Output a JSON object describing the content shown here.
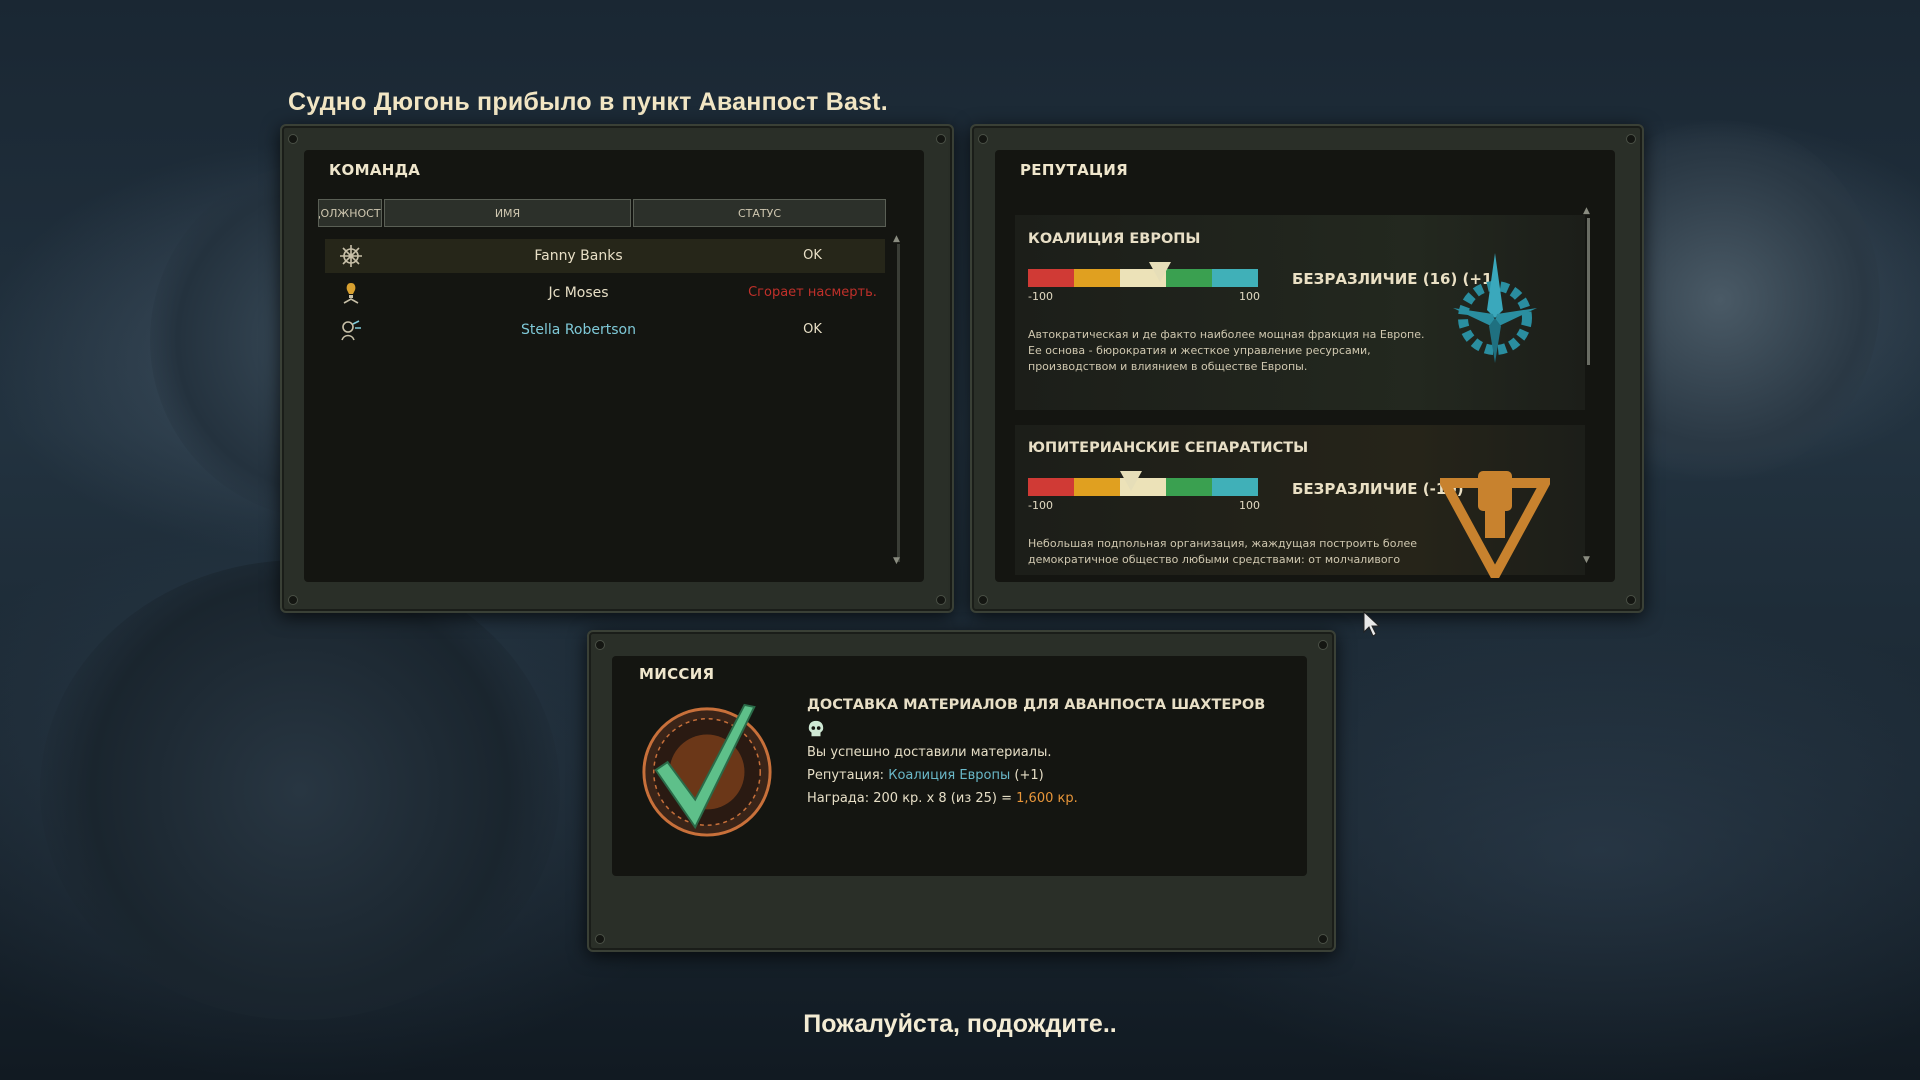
{
  "header": {
    "title": "Судно Дюгонь прибыло в пункт Аванпост Bast."
  },
  "crew": {
    "title": "КОМАНДА",
    "columns": [
      "ДОЛЖНОСТЬ",
      "ИМЯ",
      "СТАТУС"
    ],
    "rows": [
      {
        "icon": "helm-wheel-icon",
        "name": "Fanny Banks",
        "status": "OK",
        "status_color": "#e8dfc6",
        "name_color": "#e8dfc6"
      },
      {
        "icon": "engineer-icon",
        "name": "Jc Moses",
        "status": "Сгорает насмерть.",
        "status_color": "#c0302a",
        "name_color": "#e8dfc6"
      },
      {
        "icon": "scientist-icon",
        "name": "Stella Robertson",
        "status": "OK",
        "status_color": "#e8dfc6",
        "name_color": "#7fc9d8"
      }
    ]
  },
  "reputation": {
    "title": "РЕПУТАЦИЯ",
    "bar_colors": [
      "#d03a35",
      "#e0a020",
      "#ece2b8",
      "#3aa050",
      "#40b0b8"
    ],
    "bar_min": "-100",
    "bar_max": "100",
    "factions": [
      {
        "name": "КОАЛИЦИЯ ЕВРОПЫ",
        "attitude": "БЕЗРАЗЛИЧИЕ (16) (+1)",
        "value": 16,
        "description": "Автократическая и де факто наиболее мощная фракция на Европе. Ее основа - бюрократия и жесткое управление ресурсами, производством и влиянием в обществе Европы.",
        "emblem": "compass-gear-icon",
        "emblem_color": "#2a8ea0"
      },
      {
        "name": "ЮПИТЕРИАНСКИЕ СЕПАРАТИСТЫ",
        "attitude": "БЕЗРАЗЛИЧИЕ (-10)",
        "value": -10,
        "description": "Небольшая подпольная организация, жаждущая построить более демократичное общество любыми средствами: от молчаливого",
        "emblem": "fist-triangle-icon",
        "emblem_color": "#c8822e"
      }
    ]
  },
  "mission": {
    "title": "МИССИЯ",
    "name": "ДОСТАВКА МАТЕРИАЛОВ ДЛЯ АВАНПОСТА ШАХТЕРОВ",
    "result": "Вы успешно доставили материалы.",
    "rep_label": "Репутация:",
    "rep_faction": "Коалиция Европы",
    "rep_change": "(+1)",
    "reward_label": "Награда: 200 кр. x 8 (из 25) =",
    "reward_total": "1,600 кр.",
    "badge": "check-badge-icon",
    "difficulty_icon": "skull-icon"
  },
  "footer": {
    "wait": "Пожалуйста, подождите.."
  }
}
